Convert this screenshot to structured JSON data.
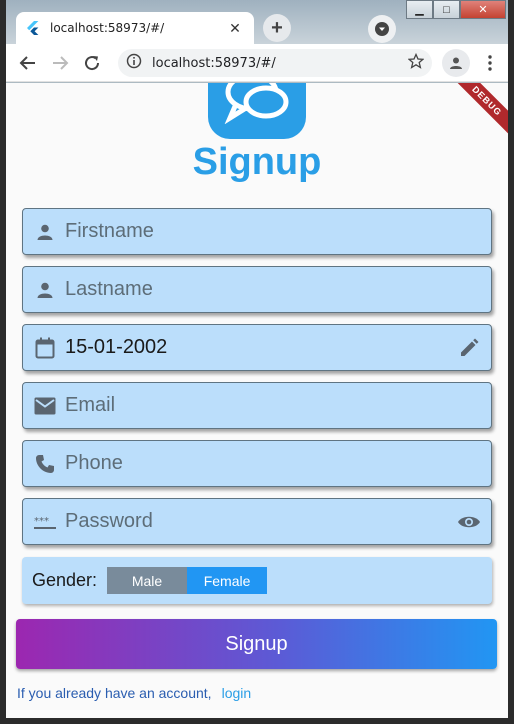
{
  "browser": {
    "tab_title": "localhost:58973/#/",
    "tab_close": "✕",
    "new_tab": "+",
    "url": "localhost:58973/#/",
    "window_controls": {
      "minimize": "▁",
      "maximize": "□",
      "close": "✕"
    }
  },
  "app": {
    "debug_banner": "DEBUG",
    "title": "Signup",
    "accent_color": "#2a9ee6",
    "field_background": "#bbdefb",
    "fields": {
      "firstname": {
        "placeholder": "Firstname",
        "icon": "person-icon"
      },
      "lastname": {
        "placeholder": "Lastname",
        "icon": "person-icon"
      },
      "dob": {
        "value": "15-01-2002",
        "icon": "calendar-icon",
        "trailing_icon": "edit-pencil-icon"
      },
      "email": {
        "placeholder": "Email",
        "icon": "mail-icon"
      },
      "phone": {
        "placeholder": "Phone",
        "icon": "phone-icon"
      },
      "password": {
        "placeholder": "Password",
        "icon": "password-icon",
        "trailing_icon": "eye-icon"
      }
    },
    "gender": {
      "label": "Gender:",
      "options": [
        "Male",
        "Female"
      ],
      "selected": "Female"
    },
    "signup_button": "Signup",
    "footer_text": "If you already have an account,",
    "login_link": "login"
  }
}
